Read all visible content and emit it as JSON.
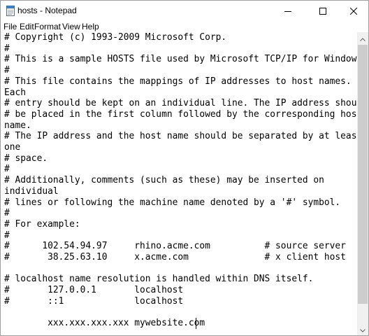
{
  "window": {
    "title": "hosts - Notepad",
    "app_icon": "notepad-icon",
    "controls": {
      "minimize_icon": "minimize-icon",
      "maximize_icon": "maximize-icon",
      "close_icon": "close-icon"
    }
  },
  "menu": {
    "items": [
      {
        "label": "File"
      },
      {
        "label": "Edit"
      },
      {
        "label": "Format"
      },
      {
        "label": "View"
      },
      {
        "label": "Help"
      }
    ]
  },
  "editor": {
    "text": "# Copyright (c) 1993-2009 Microsoft Corp.\n#\n# This is a sample HOSTS file used by Microsoft TCP/IP for Windows.\n#\n# This file contains the mappings of IP addresses to host names.\nEach\n# entry should be kept on an individual line. The IP address should\n# be placed in the first column followed by the corresponding host\nname.\n# The IP address and the host name should be separated by at least\none\n# space.\n#\n# Additionally, comments (such as these) may be inserted on\nindividual\n# lines or following the machine name denoted by a '#' symbol.\n#\n# For example:\n#\n#      102.54.94.97     rhino.acme.com          # source server\n#       38.25.63.10     x.acme.com              # x client host\n\n# localhost name resolution is handled within DNS itself.\n#       127.0.0.1       localhost\n#       ::1             localhost\n\n        xxx.xxx.xxx.xxx mywebsite.com"
  },
  "scrollbar": {
    "up_icon": "scroll-up-arrow-icon",
    "down_icon": "scroll-down-arrow-icon"
  }
}
